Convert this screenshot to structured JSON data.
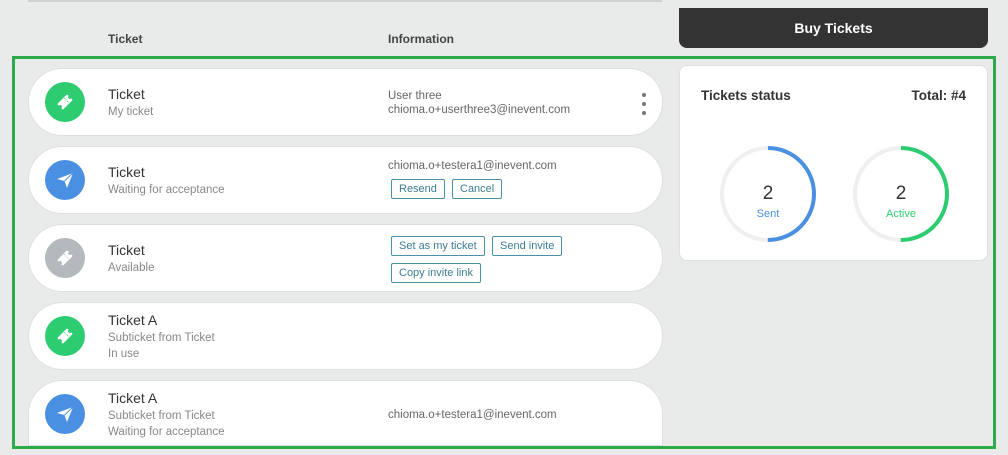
{
  "header": {
    "col_ticket": "Ticket",
    "col_information": "Information",
    "buy_button": "Buy Tickets"
  },
  "tickets": [
    {
      "title": "Ticket",
      "subtitle": "My ticket",
      "icon": "ticket-icon",
      "icon_color": "#2ecc71",
      "info_name": "User three",
      "info_email": "chioma.o+userthree3@inevent.com"
    },
    {
      "title": "Ticket",
      "subtitle": "Waiting for acceptance",
      "icon": "send-icon",
      "icon_color": "#4a90e2",
      "info_email": "chioma.o+testera1@inevent.com",
      "actions": [
        "Resend",
        "Cancel"
      ]
    },
    {
      "title": "Ticket",
      "subtitle": "Available",
      "icon": "ticket-icon",
      "icon_color": "#b4babc",
      "actions": [
        "Set as my ticket",
        "Send invite",
        "Copy invite link"
      ]
    },
    {
      "title": "Ticket A",
      "subtitle": "Subticket from Ticket",
      "subtitle2": "In use",
      "icon": "ticket-icon",
      "icon_color": "#2ecc71"
    },
    {
      "title": "Ticket A",
      "subtitle": "Subticket from Ticket",
      "subtitle2": "Waiting for acceptance",
      "icon": "send-icon",
      "icon_color": "#4a90e2",
      "info_email": "chioma.o+testera1@inevent.com"
    }
  ],
  "status": {
    "title": "Tickets status",
    "total": "Total: #4",
    "sent": {
      "value": "2",
      "label": "Sent",
      "fraction": 0.5,
      "color": "#4a90e2"
    },
    "active": {
      "value": "2",
      "label": "Active",
      "fraction": 0.5,
      "color": "#2ecc71"
    }
  }
}
